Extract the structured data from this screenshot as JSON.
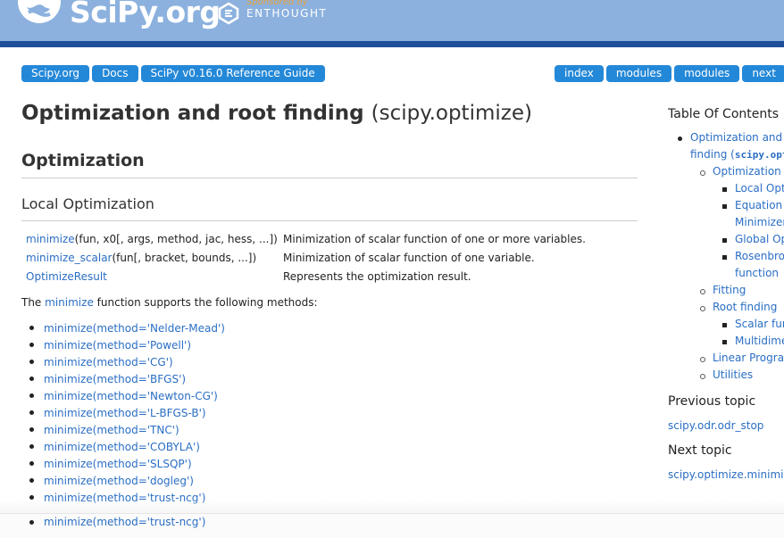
{
  "header": {
    "logo_text": "SciPy.org",
    "sponsored_text": "Sponsored by",
    "sponsor_name": "ENTHOUGHT",
    "colors": {
      "header_bg": "#8cb1de",
      "stripe": "#1f4f9b",
      "pill": "#2488d8",
      "link": "#2a6ec4"
    }
  },
  "nav": {
    "left": [
      "Scipy.org",
      "Docs",
      "SciPy v0.16.0 Reference Guide"
    ],
    "right": [
      "index",
      "modules",
      "modules",
      "next"
    ]
  },
  "main": {
    "title": "Optimization and root finding",
    "title_module": "(scipy.optimize)",
    "section": "Optimization",
    "subsection": "Local Optimization",
    "summary": [
      {
        "fn": "minimize",
        "sig": "(fun, x0[, args, method, jac, hess, ...])",
        "desc": "Minimization of scalar function of one or more variables."
      },
      {
        "fn": "minimize_scalar",
        "sig": "(fun[, bracket, bounds, ...])",
        "desc": "Minimization of scalar function of one variable."
      },
      {
        "fn": "OptimizeResult",
        "sig": "",
        "desc": "Represents the optimization result."
      }
    ],
    "para_pre": "The",
    "para_link": "minimize",
    "para_post": "function supports the following methods:",
    "methods": [
      "minimize(method='Nelder-Mead')",
      "minimize(method='Powell')",
      "minimize(method='CG')",
      "minimize(method='BFGS')",
      "minimize(method='Newton-CG')",
      "minimize(method='L-BFGS-B')",
      "minimize(method='TNC')",
      "minimize(method='COBYLA')",
      "minimize(method='SLSQP')",
      "minimize(method='dogleg')",
      "minimize(method='trust-ncg')"
    ],
    "bottom_item": "minimize(method='trust-ncg')"
  },
  "sidebar": {
    "toc_title": "Table Of Contents",
    "toc": {
      "root_line1": "Optimization and root",
      "root_line2_pre": "finding (",
      "root_line2_code": "scipy.optimize",
      "optimization": "Optimization",
      "local_opt": "Local Optimization",
      "equation_line1": "Equation (Local)",
      "equation_line2": "Minimizers",
      "global_opt": "Global Optimization",
      "rosen_line1": "Rosenbrock",
      "rosen_line2": "function",
      "fitting": "Fitting",
      "root_finding": "Root finding",
      "scalar_fn": "Scalar functions",
      "multidim": "Multidimensional",
      "linear_prog": "Linear Programming",
      "utilities": "Utilities"
    },
    "prev_heading": "Previous topic",
    "prev_link": "scipy.odr.odr_stop",
    "next_heading": "Next topic",
    "next_link": "scipy.optimize.minimize"
  }
}
